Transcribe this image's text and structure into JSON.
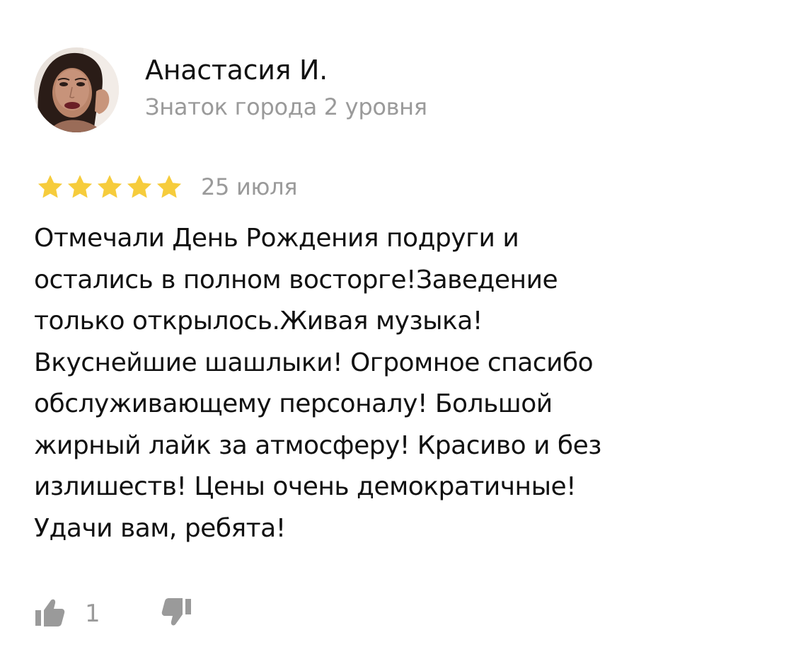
{
  "review": {
    "author": {
      "name": "Анастасия И.",
      "level": "Знаток города 2 уровня",
      "avatar_icon": "user-avatar-photo"
    },
    "rating": {
      "stars": 5,
      "max": 5,
      "star_color": "#f6cc3c"
    },
    "date": "25 июля",
    "text": "Отмечали  День Рождения подруги и\nостались в полном восторге!Заведение\nтолько открылось.Живая музыка!\nВкуснейшие шашлыки! Огромное спасибо\nобслуживающему персоналу! Большой\nжирный лайк за атмосферу! Красиво и без\nизлишеств! Цены очень демократичные!\nУдачи вам, ребята!",
    "actions": {
      "like_icon": "thumbs-up-icon",
      "like_count": "1",
      "dislike_icon": "thumbs-down-icon",
      "icon_color": "#9a9a9a"
    }
  }
}
